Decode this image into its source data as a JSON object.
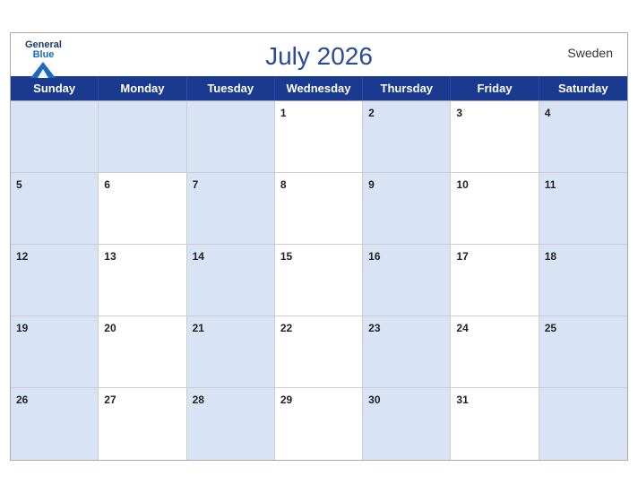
{
  "header": {
    "title": "July 2026",
    "country": "Sweden",
    "logo": {
      "general": "General",
      "blue": "Blue"
    }
  },
  "days": [
    "Sunday",
    "Monday",
    "Tuesday",
    "Wednesday",
    "Thursday",
    "Friday",
    "Saturday"
  ],
  "weeks": [
    [
      {
        "num": "",
        "shaded": true
      },
      {
        "num": "",
        "shaded": true
      },
      {
        "num": "",
        "shaded": true
      },
      {
        "num": "1",
        "shaded": false
      },
      {
        "num": "2",
        "shaded": true
      },
      {
        "num": "3",
        "shaded": false
      },
      {
        "num": "4",
        "shaded": true
      }
    ],
    [
      {
        "num": "5",
        "shaded": true
      },
      {
        "num": "6",
        "shaded": false
      },
      {
        "num": "7",
        "shaded": true
      },
      {
        "num": "8",
        "shaded": false
      },
      {
        "num": "9",
        "shaded": true
      },
      {
        "num": "10",
        "shaded": false
      },
      {
        "num": "11",
        "shaded": true
      }
    ],
    [
      {
        "num": "12",
        "shaded": true
      },
      {
        "num": "13",
        "shaded": false
      },
      {
        "num": "14",
        "shaded": true
      },
      {
        "num": "15",
        "shaded": false
      },
      {
        "num": "16",
        "shaded": true
      },
      {
        "num": "17",
        "shaded": false
      },
      {
        "num": "18",
        "shaded": true
      }
    ],
    [
      {
        "num": "19",
        "shaded": true
      },
      {
        "num": "20",
        "shaded": false
      },
      {
        "num": "21",
        "shaded": true
      },
      {
        "num": "22",
        "shaded": false
      },
      {
        "num": "23",
        "shaded": true
      },
      {
        "num": "24",
        "shaded": false
      },
      {
        "num": "25",
        "shaded": true
      }
    ],
    [
      {
        "num": "26",
        "shaded": true
      },
      {
        "num": "27",
        "shaded": false
      },
      {
        "num": "28",
        "shaded": true
      },
      {
        "num": "29",
        "shaded": false
      },
      {
        "num": "30",
        "shaded": true
      },
      {
        "num": "31",
        "shaded": false
      },
      {
        "num": "",
        "shaded": true
      }
    ]
  ]
}
